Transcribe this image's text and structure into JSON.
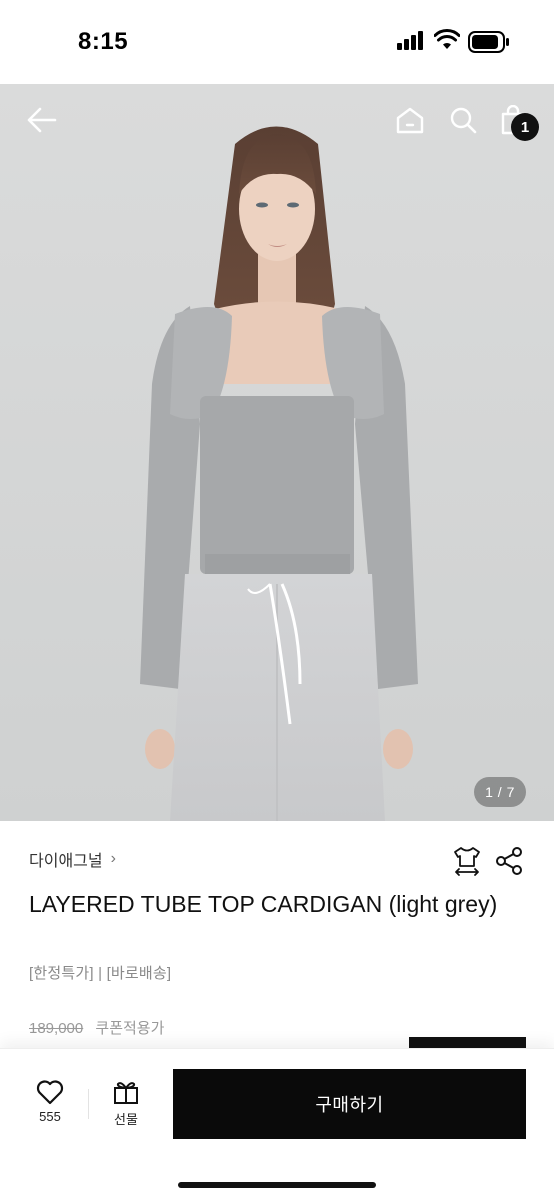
{
  "status_bar": {
    "time": "8:15"
  },
  "header": {
    "back_icon": "arrow-left-icon",
    "home_icon": "home-icon",
    "search_icon": "search-icon",
    "cart_icon": "shopping-bag-icon",
    "cart_count": "1"
  },
  "gallery": {
    "counter": "1 / 7",
    "current_image": 1,
    "total_images": 7
  },
  "product": {
    "brand": "다이애그널",
    "brand_chevron": "›",
    "title": "LAYERED TUBE TOP CARDIGAN (light grey)",
    "tags": "[한정특가] | [바로배송]",
    "original_price": "189,000",
    "price_note": "쿠폰적용가",
    "size_icon": "tshirt-size-icon",
    "share_icon": "share-icon"
  },
  "bottom_bar": {
    "like_icon": "heart-icon",
    "like_count": "555",
    "gift_icon": "gift-icon",
    "gift_label": "선물",
    "buy_label": "구매하기"
  },
  "colors": {
    "accent": "#0a0a0a",
    "background": "#ffffff",
    "muted_text": "#8a8a8a"
  }
}
